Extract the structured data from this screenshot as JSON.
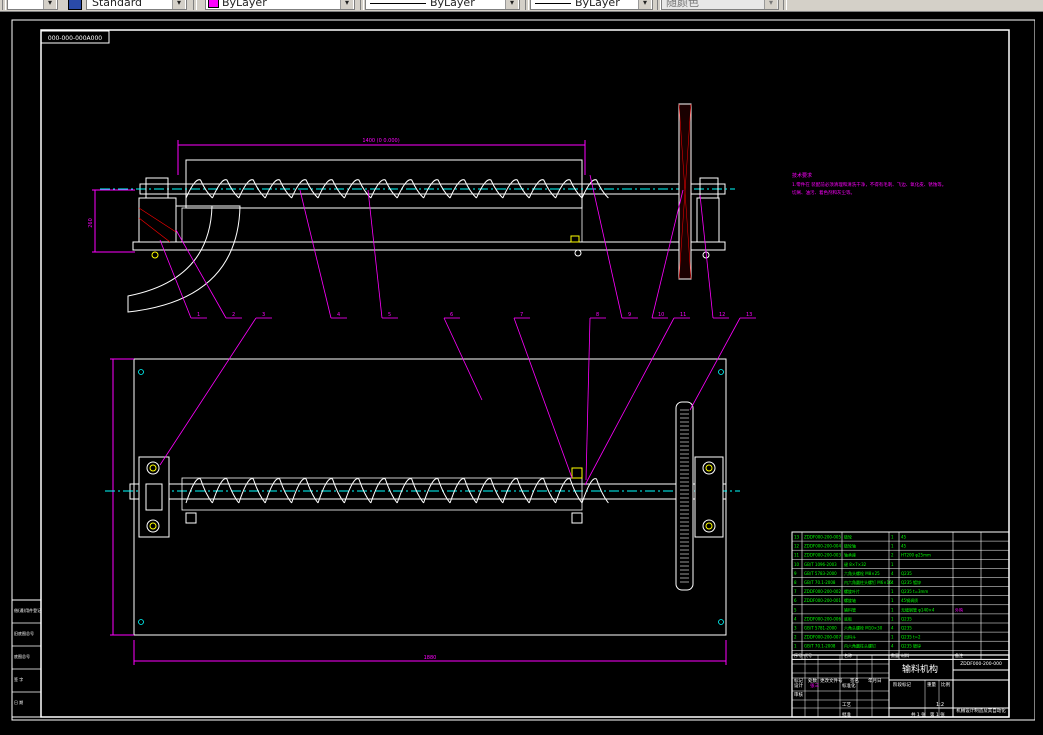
{
  "toolbar": {
    "text_style": "Standard",
    "color_layer": "ByLayer",
    "linetype": "ByLayer",
    "lineweight": "ByLayer",
    "plot_style": "随颜色"
  },
  "drawing": {
    "frame_tag": "000-000-000A000",
    "assembly_title": "输料机构",
    "drawing_number": "ZDDF000-200-000",
    "total_length_dim": "1880",
    "upper_dim": "1400 (0 0.000)",
    "height_dim": "260",
    "notes_title": "技术要求",
    "notes_line1": "1.零件在 装配前必须清理和清洗干净，不得有毛刺、飞边、氧化皮、锈蚀等。",
    "notes_line2": "  切屑、油污、着色剂和灰尘等。",
    "callouts": [
      "1",
      "2",
      "3",
      "4",
      "5",
      "6",
      "7",
      "8",
      "9",
      "10",
      "11",
      "12",
      "13"
    ],
    "scale": "1:2",
    "sheet": "1",
    "school": "机械设计制造及其自动化",
    "bom": [
      {
        "no": "13",
        "code": "ZDDF000-200-005",
        "name": "链轮",
        "qty": "1",
        "material": "45",
        "note": ""
      },
      {
        "no": "12",
        "code": "ZDDF000-200-004",
        "name": "链轮轴",
        "qty": "1",
        "material": "45",
        "note": ""
      },
      {
        "no": "11",
        "code": "ZDDF000-200-003",
        "name": "轴承座",
        "qty": "2",
        "material": "HT200 φ25mm",
        "note": ""
      },
      {
        "no": "10",
        "code": "GB/T 1096-2003",
        "name": "键 8×7×32",
        "qty": "1",
        "material": "",
        "note": ""
      },
      {
        "no": "9",
        "code": "GB/T 5783-2000",
        "name": "六角头螺栓 M8×25",
        "qty": "4",
        "material": "Q235",
        "note": ""
      },
      {
        "no": "8",
        "code": "GB/T 70.1-2008",
        "name": "内六角圆柱头螺钉 M6×16",
        "qty": "4",
        "material": "Q235 镀锌",
        "note": ""
      },
      {
        "no": "7",
        "code": "ZDDF000-200-002",
        "name": "螺旋叶片",
        "qty": "1",
        "material": "Q235 t=3mm",
        "note": ""
      },
      {
        "no": "6",
        "code": "ZDDF000-200-001",
        "name": "螺旋轴",
        "qty": "1",
        "material": "45钢调质",
        "note": ""
      },
      {
        "no": "5",
        "code": "",
        "name": "输料管",
        "qty": "1",
        "material": "无缝钢管 φ140×4",
        "note": "外购"
      },
      {
        "no": "4",
        "code": "ZDDF000-200-006",
        "name": "底板",
        "qty": "1",
        "material": "Q235",
        "note": ""
      },
      {
        "no": "3",
        "code": "GB/T 5781-2000",
        "name": "六角头螺栓 M10×30",
        "qty": "4",
        "material": "Q235",
        "note": ""
      },
      {
        "no": "2",
        "code": "ZDDF000-200-007",
        "name": "出料斗",
        "qty": "1",
        "material": "Q235 t=2",
        "note": ""
      },
      {
        "no": "1",
        "code": "GB/T 70.1-2008",
        "name": "内六角圆柱头螺钉",
        "qty": "4",
        "material": "Q235 镀锌",
        "note": ""
      }
    ],
    "bom_header": {
      "no": "序号",
      "code": "代号",
      "name": "名称",
      "qty": "数量",
      "material": "材料",
      "note": "备注"
    },
    "title_labels": {
      "mark": "标记",
      "count": "处数",
      "zone": "分区",
      "change": "更改文件号",
      "sign": "签名",
      "date": "年月日",
      "design": "设计",
      "standard": "标准化",
      "stage": "阶段标记",
      "weight": "重量",
      "scale_lbl": "比例",
      "review": "审核",
      "process": "工艺",
      "approve": "批准",
      "total": "共 1 张",
      "page": "第 1 张",
      "designer": "张三"
    },
    "side_block": [
      "借(通)用件登记",
      "旧底图总号",
      "底图总号",
      "签 字",
      "日 期"
    ]
  }
}
